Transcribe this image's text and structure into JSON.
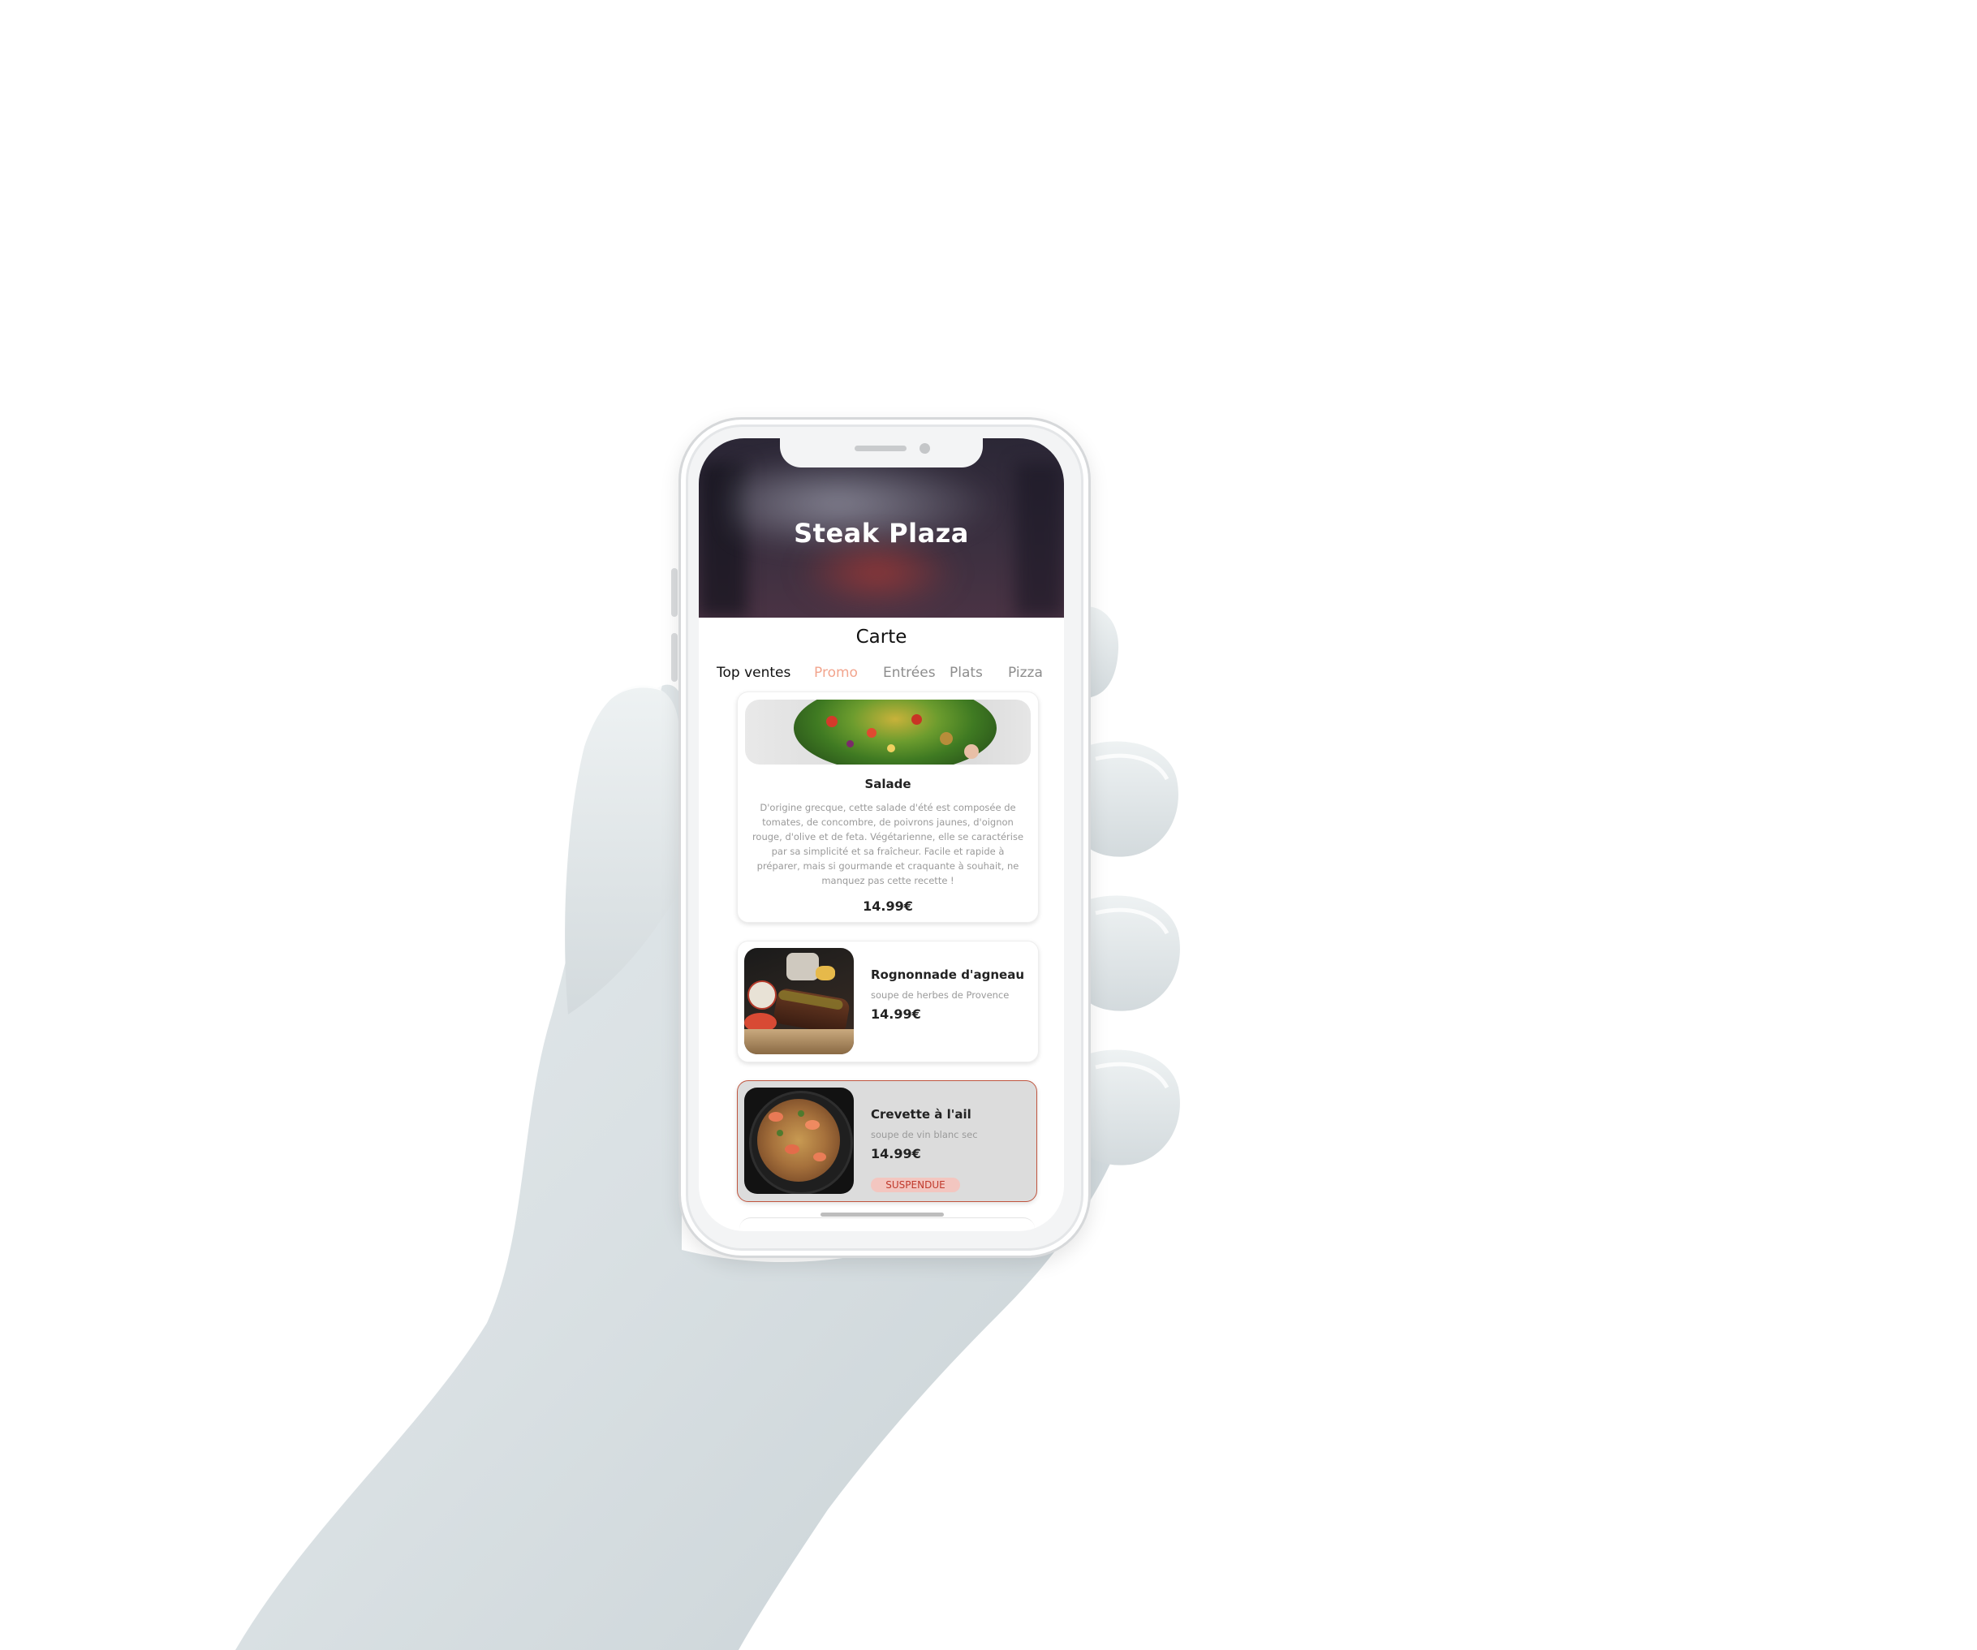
{
  "restaurant": {
    "name": "Steak Plaza"
  },
  "menu": {
    "section_title": "Carte",
    "tabs": [
      {
        "label": "Top ventes",
        "state": "active"
      },
      {
        "label": "Promo",
        "state": "highlighted"
      },
      {
        "label": "Entrées",
        "state": "normal"
      },
      {
        "label": "Plats",
        "state": "normal"
      },
      {
        "label": "Pizza",
        "state": "normal"
      }
    ],
    "items": [
      {
        "name": "Salade",
        "description": "D'origine grecque, cette salade d'été est composée de tomates, de concombre, de poivrons jaunes, d'oignon rouge, d'olive et de feta. Végétarienne, elle se caractérise par sa simplicité et sa fraîcheur. Facile et rapide à préparer, mais si gourmande et craquante à souhait, ne manquez pas cette recette !",
        "price": "14.99€"
      },
      {
        "name": "Rognonnade d'agneau",
        "subtitle": "soupe de herbes de Provence",
        "price": "14.99€"
      },
      {
        "name": "Crevette à l'ail",
        "subtitle": "soupe de vin blanc sec",
        "price": "14.99€",
        "status": "SUSPENDUE"
      }
    ]
  },
  "colors": {
    "promo_tab": "#f2a58e",
    "suspended_border": "#c0553f",
    "suspended_badge_bg": "#f3c6c0",
    "suspended_badge_text": "#c0392b",
    "suspended_card_bg": "#dcdcdc"
  }
}
